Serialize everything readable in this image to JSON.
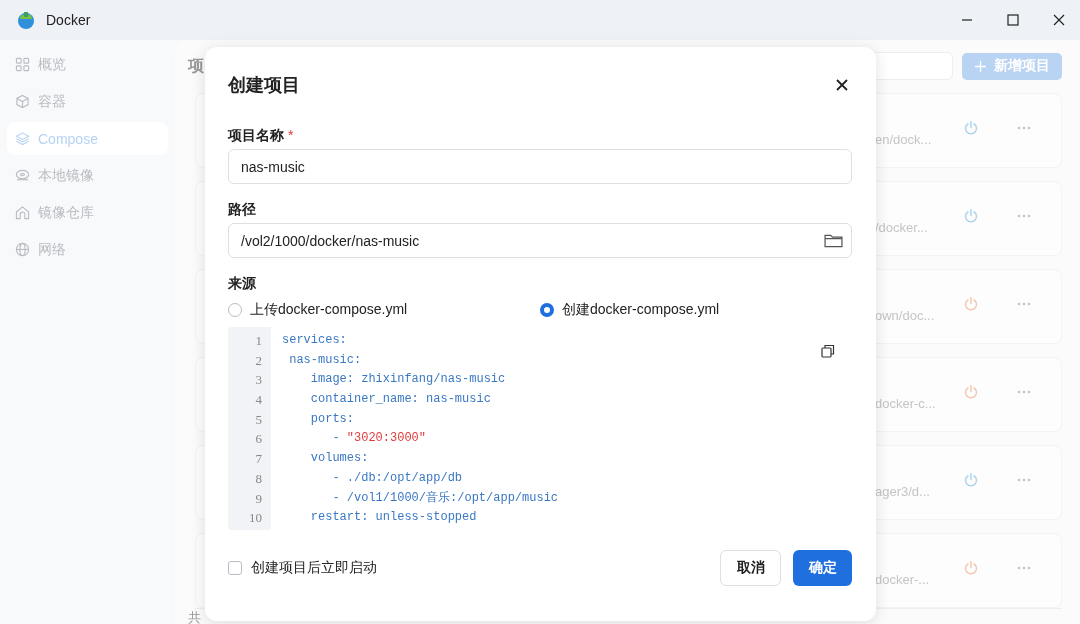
{
  "window": {
    "title": "Docker"
  },
  "sidebar": {
    "items": [
      {
        "label": "概览",
        "selected": false
      },
      {
        "label": "容器",
        "selected": false
      },
      {
        "label": "Compose",
        "selected": true
      },
      {
        "label": "本地镜像",
        "selected": false
      },
      {
        "label": "镜像仓库",
        "selected": false
      },
      {
        "label": "网络",
        "selected": false
      }
    ]
  },
  "page": {
    "title": "项",
    "footer": "共",
    "add_button": "新增项目"
  },
  "projects": [
    {
      "path": "en/dock...",
      "running": true
    },
    {
      "path": "/docker...",
      "running": true
    },
    {
      "path": "own/doc...",
      "running": false
    },
    {
      "path": "docker-c...",
      "running": false
    },
    {
      "path": "ager3/d...",
      "running": true
    },
    {
      "path": "docker-...",
      "running": false
    }
  ],
  "dialog": {
    "title": "创建项目",
    "name_label": "项目名称",
    "required_mark": "*",
    "name_value": "nas-music",
    "path_label": "路径",
    "path_value": "/vol2/1000/docker/nas-music",
    "source_label": "来源",
    "sources": [
      {
        "label": "上传docker-compose.yml",
        "selected": false
      },
      {
        "label": "创建docker-compose.yml",
        "selected": true
      }
    ],
    "code": [
      {
        "number": "1",
        "segments": [
          {
            "text": "services:",
            "kind": "key"
          }
        ]
      },
      {
        "number": "2",
        "segments": [
          {
            "text": " nas-music:",
            "kind": "key"
          }
        ]
      },
      {
        "number": "3",
        "segments": [
          {
            "text": "    image: zhixinfang/nas-music",
            "kind": "key"
          }
        ]
      },
      {
        "number": "4",
        "segments": [
          {
            "text": "    container_name: nas-music",
            "kind": "key"
          }
        ]
      },
      {
        "number": "5",
        "segments": [
          {
            "text": "    ports:",
            "kind": "key"
          }
        ]
      },
      {
        "number": "6",
        "segments": [
          {
            "text": "       - ",
            "kind": "key"
          },
          {
            "text": "\"3020:3000\"",
            "kind": "string"
          }
        ]
      },
      {
        "number": "7",
        "segments": [
          {
            "text": "    volumes:",
            "kind": "key"
          }
        ]
      },
      {
        "number": "8",
        "segments": [
          {
            "text": "       - ./db:/opt/app/db",
            "kind": "key"
          }
        ]
      },
      {
        "number": "9",
        "segments": [
          {
            "text": "       - /vol1/1000/音乐:/opt/app/music",
            "kind": "key"
          }
        ]
      },
      {
        "number": "10",
        "segments": [
          {
            "text": "    restart: unless-stopped",
            "kind": "key"
          }
        ]
      }
    ],
    "autostart": {
      "label": "创建项目后立即启动",
      "checked": false
    },
    "cancel": "取消",
    "confirm": "确定"
  }
}
